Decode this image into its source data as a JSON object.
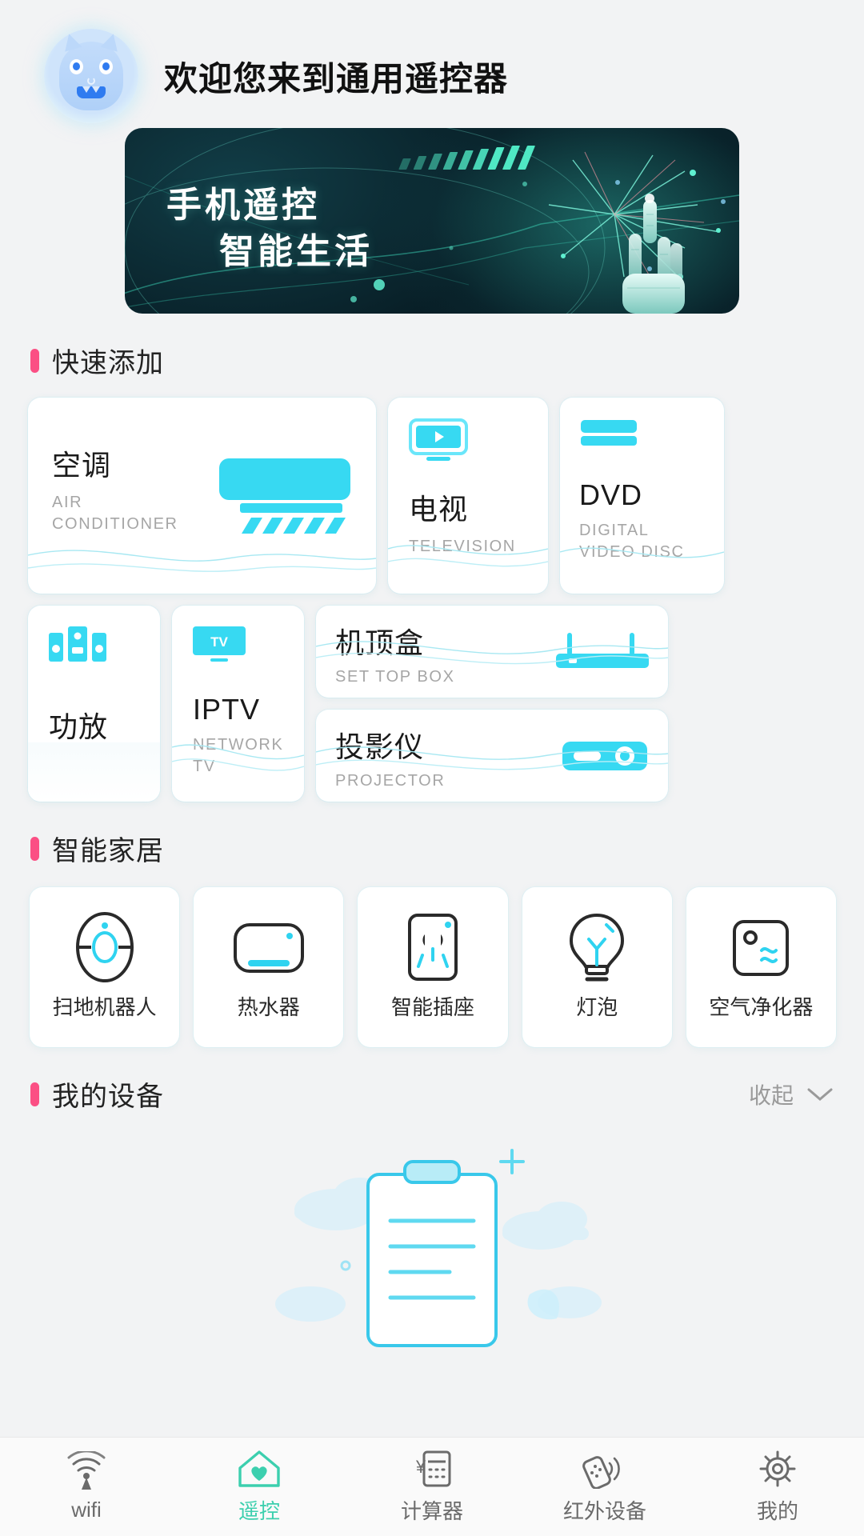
{
  "header": {
    "avatar_icon": "monster-avatar-icon",
    "title": "欢迎您来到通用遥控器"
  },
  "banner": {
    "line1": "手机遥控",
    "line2": "智能生活"
  },
  "quick_add": {
    "section_label": "快速添加",
    "accent_color": "#fb4f84",
    "items": [
      {
        "name": "空调",
        "sub": "AIR CONDITIONER",
        "icon": "air-conditioner-icon"
      },
      {
        "name": "电视",
        "sub": "TELEVISION",
        "icon": "television-icon"
      },
      {
        "name": "DVD",
        "sub": "DIGITAL VIDEO DISC",
        "icon": "dvd-player-icon"
      },
      {
        "name": "功放",
        "sub": "",
        "icon": "amplifier-speaker-icon"
      },
      {
        "name": "IPTV",
        "sub": "NETWORK TV",
        "icon": "iptv-icon"
      },
      {
        "name": "机顶盒",
        "sub": "SET TOP BOX",
        "icon": "set-top-box-icon"
      },
      {
        "name": "投影仪",
        "sub": "PROJECTOR",
        "icon": "projector-icon"
      }
    ]
  },
  "smart_home": {
    "section_label": "智能家居",
    "items": [
      {
        "name": "扫地机器人",
        "icon": "robot-vacuum-icon"
      },
      {
        "name": "热水器",
        "icon": "water-heater-icon"
      },
      {
        "name": "智能插座",
        "icon": "smart-socket-icon"
      },
      {
        "name": "灯泡",
        "icon": "light-bulb-icon"
      },
      {
        "name": "空气净化器",
        "icon": "air-purifier-icon"
      }
    ]
  },
  "my_devices": {
    "section_label": "我的设备",
    "collapse_label": "收起",
    "collapse_icon": "chevron-down-icon",
    "empty_illustration": "clipboard-clouds-illustration"
  },
  "tabbar": {
    "active_color": "#3ccfae",
    "items": [
      {
        "label": "wifi",
        "icon": "wifi-icon",
        "active": false
      },
      {
        "label": "遥控",
        "icon": "home-remote-icon",
        "active": true
      },
      {
        "label": "计算器",
        "icon": "calculator-icon",
        "active": false
      },
      {
        "label": "红外设备",
        "icon": "infrared-remote-icon",
        "active": false
      },
      {
        "label": "我的",
        "icon": "gear-icon",
        "active": false
      }
    ]
  }
}
